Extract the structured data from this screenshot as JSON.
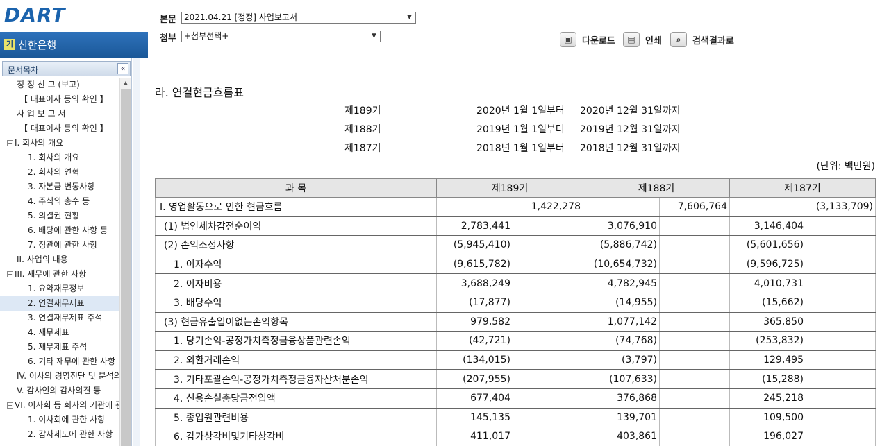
{
  "header": {
    "logo_text": "DART",
    "company": {
      "icon_text": "기",
      "name": "신한은행"
    },
    "main_doc_label": "본문",
    "main_doc_value": "2021.04.21  [정정] 사업보고서",
    "attach_label": "첨부",
    "attach_value": "+첨부선택+",
    "buttons": {
      "download": "다운로드",
      "print": "인쇄",
      "search_results": "검색결과로"
    }
  },
  "sidebar": {
    "title": "문서목차",
    "items": [
      {
        "label": "정 정 신 고 (보고)",
        "indent": 1,
        "toggle": ""
      },
      {
        "label": "【 대표이사 등의 확인 】",
        "indent": 2,
        "toggle": ""
      },
      {
        "label": "사 업 보 고 서",
        "indent": 1,
        "toggle": ""
      },
      {
        "label": "【 대표이사 등의 확인 】",
        "indent": 2,
        "toggle": ""
      },
      {
        "label": "I. 회사의 개요",
        "indent": 0,
        "toggle": "−"
      },
      {
        "label": "1. 회사의 개요",
        "indent": 3,
        "toggle": ""
      },
      {
        "label": "2. 회사의 연혁",
        "indent": 3,
        "toggle": ""
      },
      {
        "label": "3. 자본금 변동사항",
        "indent": 3,
        "toggle": ""
      },
      {
        "label": "4. 주식의 총수 등",
        "indent": 3,
        "toggle": ""
      },
      {
        "label": "5. 의결권 현황",
        "indent": 3,
        "toggle": ""
      },
      {
        "label": "6. 배당에 관한 사항 등",
        "indent": 3,
        "toggle": ""
      },
      {
        "label": "7. 정관에 관한 사항",
        "indent": 3,
        "toggle": ""
      },
      {
        "label": "II. 사업의 내용",
        "indent": 1,
        "toggle": ""
      },
      {
        "label": "III. 재무에 관한 사항",
        "indent": 0,
        "toggle": "−"
      },
      {
        "label": "1. 요약재무정보",
        "indent": 3,
        "toggle": ""
      },
      {
        "label": "2. 연결재무제표",
        "indent": 3,
        "toggle": "",
        "selected": true
      },
      {
        "label": "3. 연결재무제표 주석",
        "indent": 3,
        "toggle": ""
      },
      {
        "label": "4. 재무제표",
        "indent": 3,
        "toggle": ""
      },
      {
        "label": "5. 재무제표 주석",
        "indent": 3,
        "toggle": ""
      },
      {
        "label": "6. 기타 재무에 관한 사항",
        "indent": 3,
        "toggle": ""
      },
      {
        "label": "IV. 이사의 경영진단 및 분석의견",
        "indent": 1,
        "toggle": ""
      },
      {
        "label": "V. 감사인의 감사의견 등",
        "indent": 1,
        "toggle": ""
      },
      {
        "label": "VI. 이사회 등 회사의 기관에 관한 사항",
        "indent": 0,
        "toggle": "−"
      },
      {
        "label": "1. 이사회에 관한 사항",
        "indent": 3,
        "toggle": ""
      },
      {
        "label": "2. 감사제도에 관한 사항",
        "indent": 3,
        "toggle": ""
      }
    ]
  },
  "content": {
    "title": "라. 연결현금흐름표",
    "periods": [
      {
        "term": "제189기",
        "from": "2020년 1월 1일부터",
        "to": "2020년 12월 31일까지"
      },
      {
        "term": "제188기",
        "from": "2019년 1월 1일부터",
        "to": "2019년 12월 31일까지"
      },
      {
        "term": "제187기",
        "from": "2018년 1월 1일부터",
        "to": "2018년 12월 31일까지"
      }
    ],
    "unit": "(단위: 백만원)",
    "table": {
      "headers": [
        "과          목",
        "제189기",
        "제188기",
        "제187기"
      ],
      "rows": [
        {
          "item": "Ⅰ. 영업활동으로 인한 현금흐름",
          "v": [
            "",
            "1,422,278",
            "",
            "7,606,764",
            "",
            "(3,133,709)"
          ]
        },
        {
          "item": "(1) 법인세차감전순이익",
          "v": [
            "2,783,441",
            "",
            "3,076,910",
            "",
            "3,146,404",
            ""
          ]
        },
        {
          "item": "(2) 손익조정사항",
          "v": [
            "(5,945,410)",
            "",
            "(5,886,742)",
            "",
            "(5,601,656)",
            ""
          ]
        },
        {
          "item": "1. 이자수익",
          "v": [
            "(9,615,782)",
            "",
            "(10,654,732)",
            "",
            "(9,596,725)",
            ""
          ]
        },
        {
          "item": "2. 이자비용",
          "v": [
            "3,688,249",
            "",
            "4,782,945",
            "",
            "4,010,731",
            ""
          ]
        },
        {
          "item": "3. 배당수익",
          "v": [
            "(17,877)",
            "",
            "(14,955)",
            "",
            "(15,662)",
            ""
          ]
        },
        {
          "item": "(3) 현금유출입이없는손익항목",
          "v": [
            "979,582",
            "",
            "1,077,142",
            "",
            "365,850",
            ""
          ]
        },
        {
          "item": "1. 당기손익-공정가치측정금융상품관련손익",
          "v": [
            "(42,721)",
            "",
            "(74,768)",
            "",
            "(253,832)",
            ""
          ]
        },
        {
          "item": "2. 외환거래손익",
          "v": [
            "(134,015)",
            "",
            "(3,797)",
            "",
            "129,495",
            ""
          ]
        },
        {
          "item": "3. 기타포괄손익-공정가치측정금융자산처분손익",
          "v": [
            "(207,955)",
            "",
            "(107,633)",
            "",
            "(15,288)",
            ""
          ]
        },
        {
          "item": "4. 신용손실충당금전입액",
          "v": [
            "677,404",
            "",
            "376,868",
            "",
            "245,218",
            ""
          ]
        },
        {
          "item": "5. 종업원관련비용",
          "v": [
            "145,135",
            "",
            "139,701",
            "",
            "109,500",
            ""
          ]
        },
        {
          "item": "6. 감가상각비및기타상각비",
          "v": [
            "411,017",
            "",
            "403,861",
            "",
            "196,027",
            ""
          ]
        }
      ]
    }
  }
}
